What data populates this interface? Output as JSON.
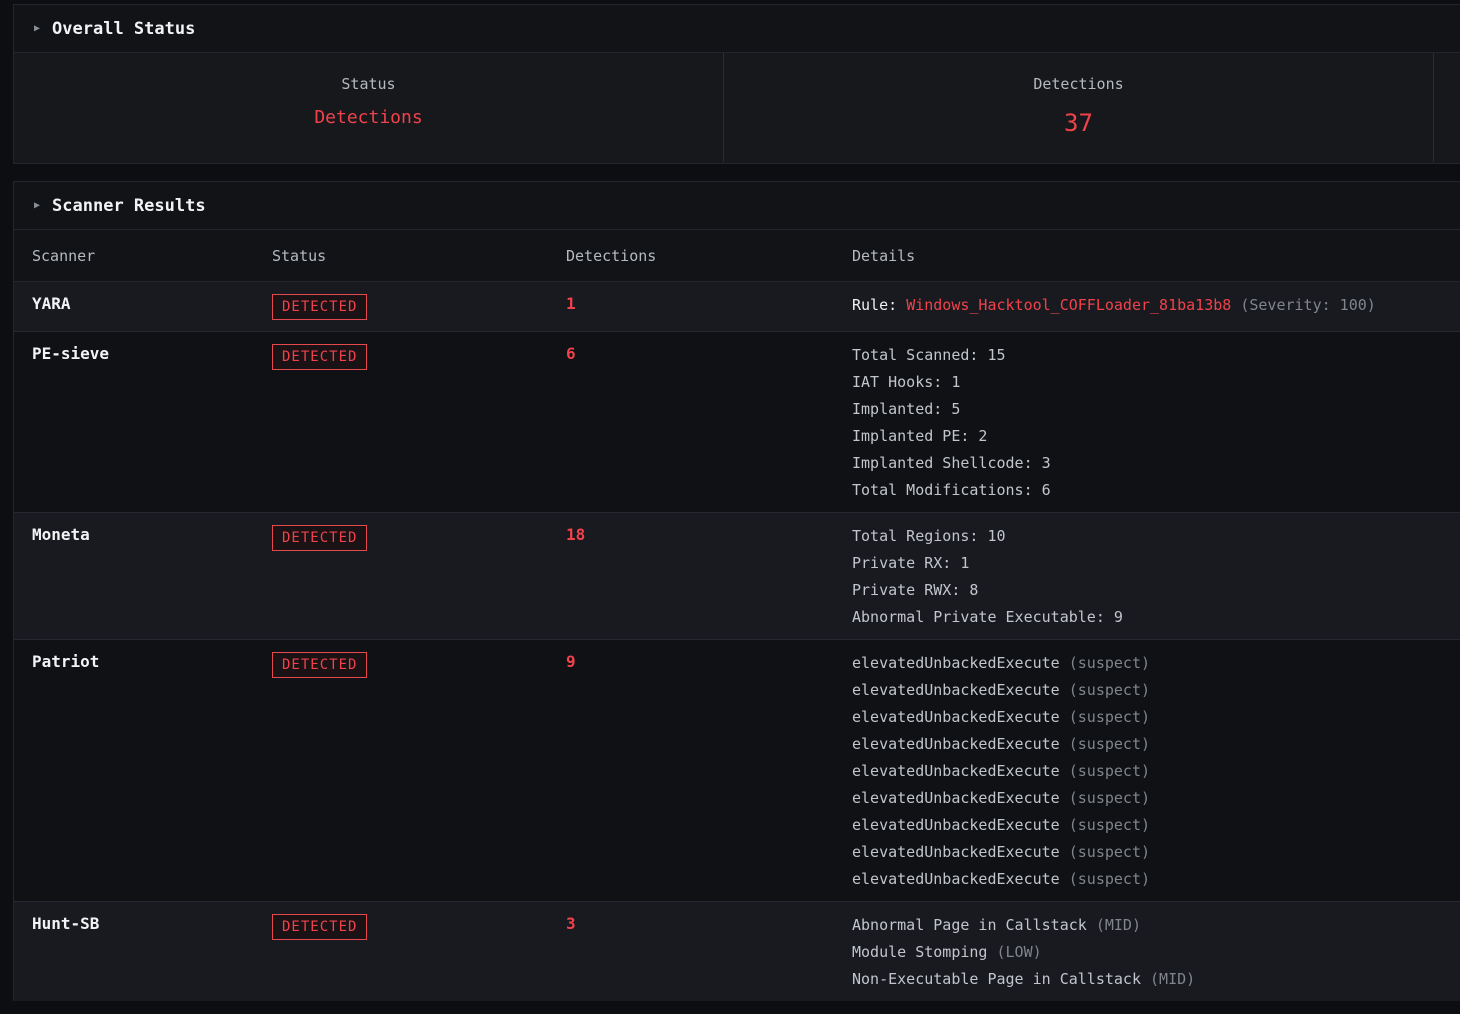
{
  "overall": {
    "title": "Overall Status",
    "status_label": "Status",
    "status_value": "Detections",
    "detections_label": "Detections",
    "detections_value": "37"
  },
  "scanner_results": {
    "title": "Scanner Results",
    "columns": [
      "Scanner",
      "Status",
      "Detections",
      "Details"
    ],
    "rows": [
      {
        "scanner": "YARA",
        "status": "DETECTED",
        "detections": "1",
        "rule_prefix": "Rule:",
        "rule_name": "Windows_Hacktool_COFFLoader_81ba13b8",
        "rule_suffix": "(Severity: 100)"
      },
      {
        "scanner": "PE-sieve",
        "status": "DETECTED",
        "detections": "6",
        "details": [
          "Total Scanned: 15",
          "IAT Hooks: 1",
          "Implanted: 5",
          "Implanted PE: 2",
          "Implanted Shellcode: 3",
          "Total Modifications: 6"
        ]
      },
      {
        "scanner": "Moneta",
        "status": "DETECTED",
        "detections": "18",
        "details": [
          "Total Regions: 10",
          "Private RX: 1",
          "Private RWX: 8",
          "Abnormal Private Executable: 9"
        ]
      },
      {
        "scanner": "Patriot",
        "status": "DETECTED",
        "detections": "9",
        "details": [
          {
            "text": "elevatedUnbackedExecute",
            "tag": "(suspect)"
          },
          {
            "text": "elevatedUnbackedExecute",
            "tag": "(suspect)"
          },
          {
            "text": "elevatedUnbackedExecute",
            "tag": "(suspect)"
          },
          {
            "text": "elevatedUnbackedExecute",
            "tag": "(suspect)"
          },
          {
            "text": "elevatedUnbackedExecute",
            "tag": "(suspect)"
          },
          {
            "text": "elevatedUnbackedExecute",
            "tag": "(suspect)"
          },
          {
            "text": "elevatedUnbackedExecute",
            "tag": "(suspect)"
          },
          {
            "text": "elevatedUnbackedExecute",
            "tag": "(suspect)"
          },
          {
            "text": "elevatedUnbackedExecute",
            "tag": "(suspect)"
          }
        ]
      },
      {
        "scanner": "Hunt-SB",
        "status": "DETECTED",
        "detections": "3",
        "details": [
          {
            "text": "Abnormal Page in Callstack",
            "tag": "(MID)"
          },
          {
            "text": "Module Stomping",
            "tag": "(LOW)"
          },
          {
            "text": "Non-Executable Page in Callstack",
            "tag": "(MID)"
          }
        ]
      }
    ]
  },
  "colors": {
    "accent_red": "#f0424b",
    "background": "#0d0e11",
    "panel": "#16181c"
  },
  "icons": {
    "section_toggle": "chevron-right-icon"
  }
}
